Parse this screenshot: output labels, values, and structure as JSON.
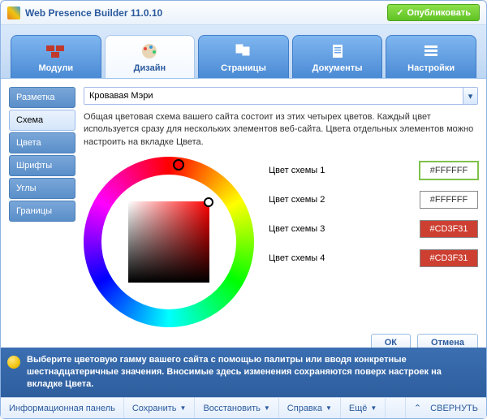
{
  "titlebar": {
    "title": "Web Presence Builder 11.0.10",
    "publish": "Опубликовать"
  },
  "tabs": {
    "t0": "Модули",
    "t1": "Дизайн",
    "t2": "Страницы",
    "t3": "Документы",
    "t4": "Настройки"
  },
  "side": {
    "s0": "Разметка",
    "s1": "Схема",
    "s2": "Цвета",
    "s3": "Шрифты",
    "s4": "Углы",
    "s5": "Границы"
  },
  "scheme": {
    "selected": "Кровавая Мэри"
  },
  "desc": "Общая цветовая схема вашего сайта состоит из этих четырех цветов. Каждый цвет используется сразу для нескольких элементов веб-сайта. Цвета отдельных элементов можно настроить на вкладке Цвета.",
  "rows": {
    "l1": "Цвет схемы 1",
    "v1": "#FFFFFF",
    "l2": "Цвет схемы 2",
    "v2": "#FFFFFF",
    "l3": "Цвет схемы 3",
    "v3": "#CD3F31",
    "l4": "Цвет схемы 4",
    "v4": "#CD3F31"
  },
  "buttons": {
    "ok": "ОК",
    "cancel": "Отмена"
  },
  "tip": "Выберите цветовую гамму вашего сайта с помощью палитры или вводя конкретные шестнадцатеричные значения. Вносимые здесь изменения сохраняются поверх настроек на вкладке Цвета.",
  "footer": {
    "f0": "Информационная панель",
    "f1": "Сохранить",
    "f2": "Восстановить",
    "f3": "Справка",
    "f4": "Ещё",
    "f5": "СВЕРНУТЬ"
  }
}
